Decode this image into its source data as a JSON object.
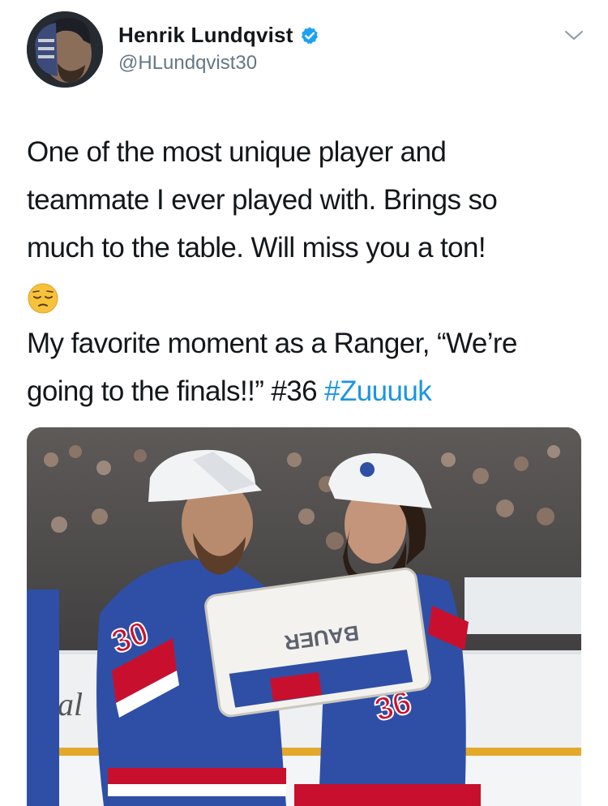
{
  "author": {
    "name": "Henrik Lundqvist",
    "handle": "@HLundqvist30",
    "verified": true
  },
  "tweet": {
    "line1": "One of the most unique player and",
    "line2": "teammate I ever played with. Brings so",
    "line3": "much to the table. Will miss you a ton!",
    "emoji": "pensive-face",
    "line4": "My favorite moment as a Ranger, “We’re",
    "line5_text": "going to the finals!!” #36 ",
    "hashtag": "#Zuuuuk"
  },
  "media": {
    "description": "Two New York Rangers players embracing on ice",
    "jersey_numbers": [
      "30",
      "36"
    ],
    "pad_brand": "BAUER",
    "board_text": "al"
  },
  "colors": {
    "link": "#1b95e0",
    "secondary_text": "#657786",
    "verified": "#1da1f2",
    "rangers_blue": "#2f4fa6",
    "rangers_red": "#c8102e"
  },
  "icons": [
    "verified-badge-icon",
    "chevron-down-icon",
    "pensive-face-emoji"
  ]
}
